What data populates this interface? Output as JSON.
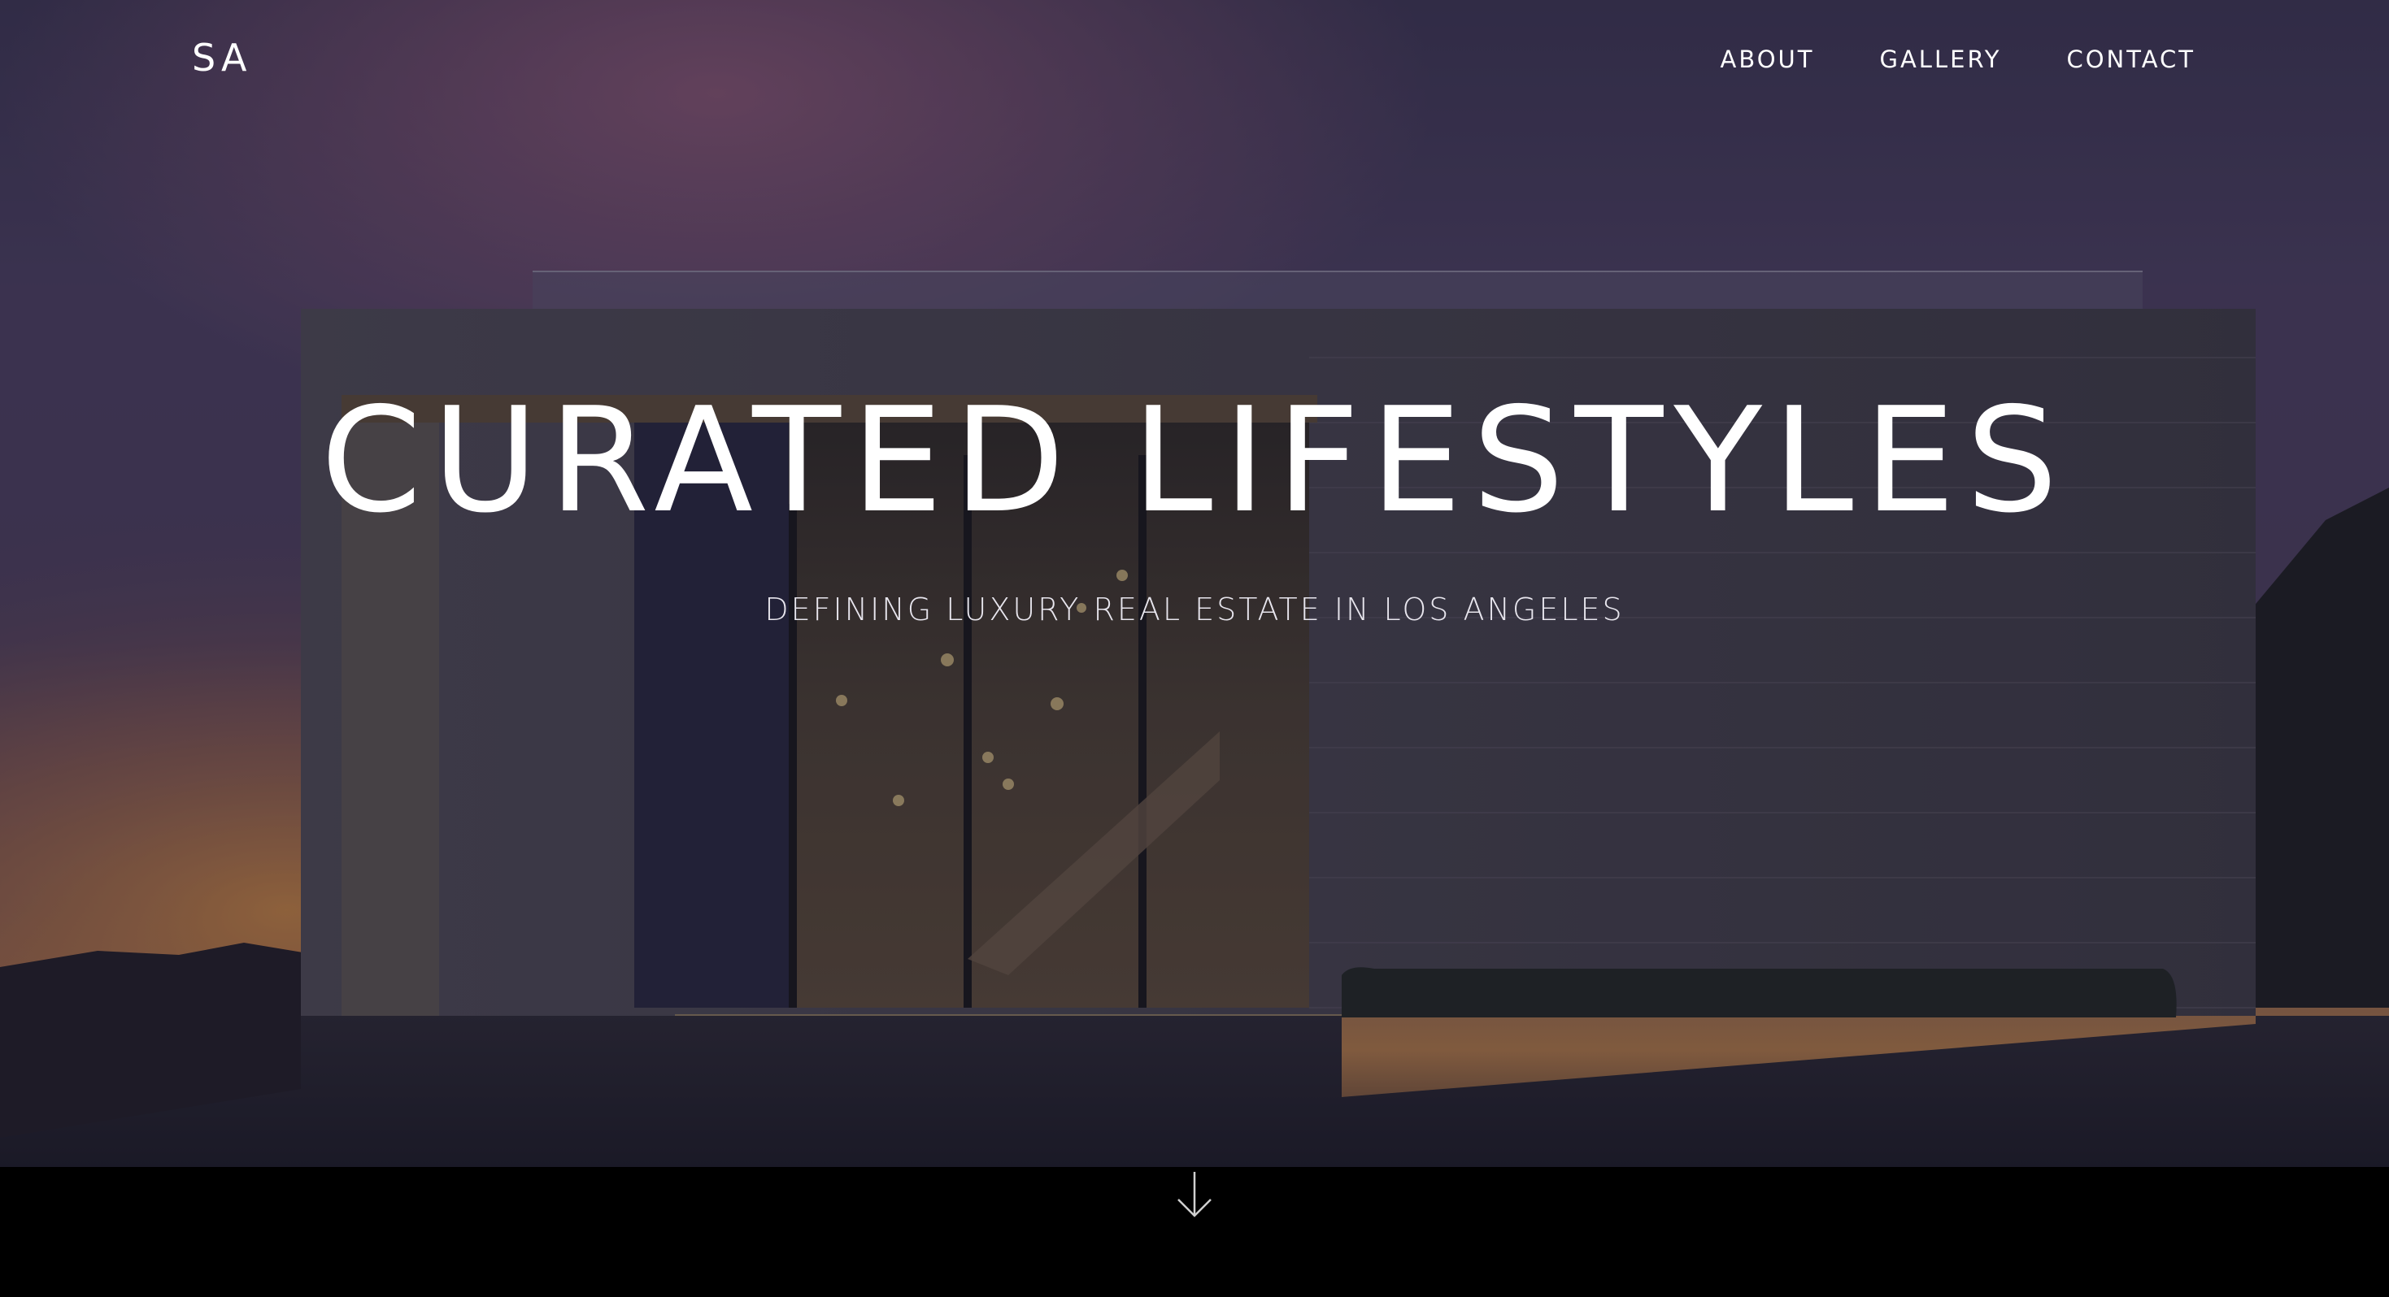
{
  "header": {
    "logo": "SA",
    "nav": [
      {
        "label": "ABOUT"
      },
      {
        "label": "GALLERY"
      },
      {
        "label": "CONTACT"
      }
    ]
  },
  "hero": {
    "title": "CURATED LIFESTYLES",
    "subtitle": "DEFINING LUXURY REAL ESTATE IN LOS ANGELES",
    "scroll_icon": "arrow-down-icon"
  },
  "colors": {
    "text": "#ffffff",
    "footer_band": "#000000",
    "overlay": "#1b1a33"
  }
}
